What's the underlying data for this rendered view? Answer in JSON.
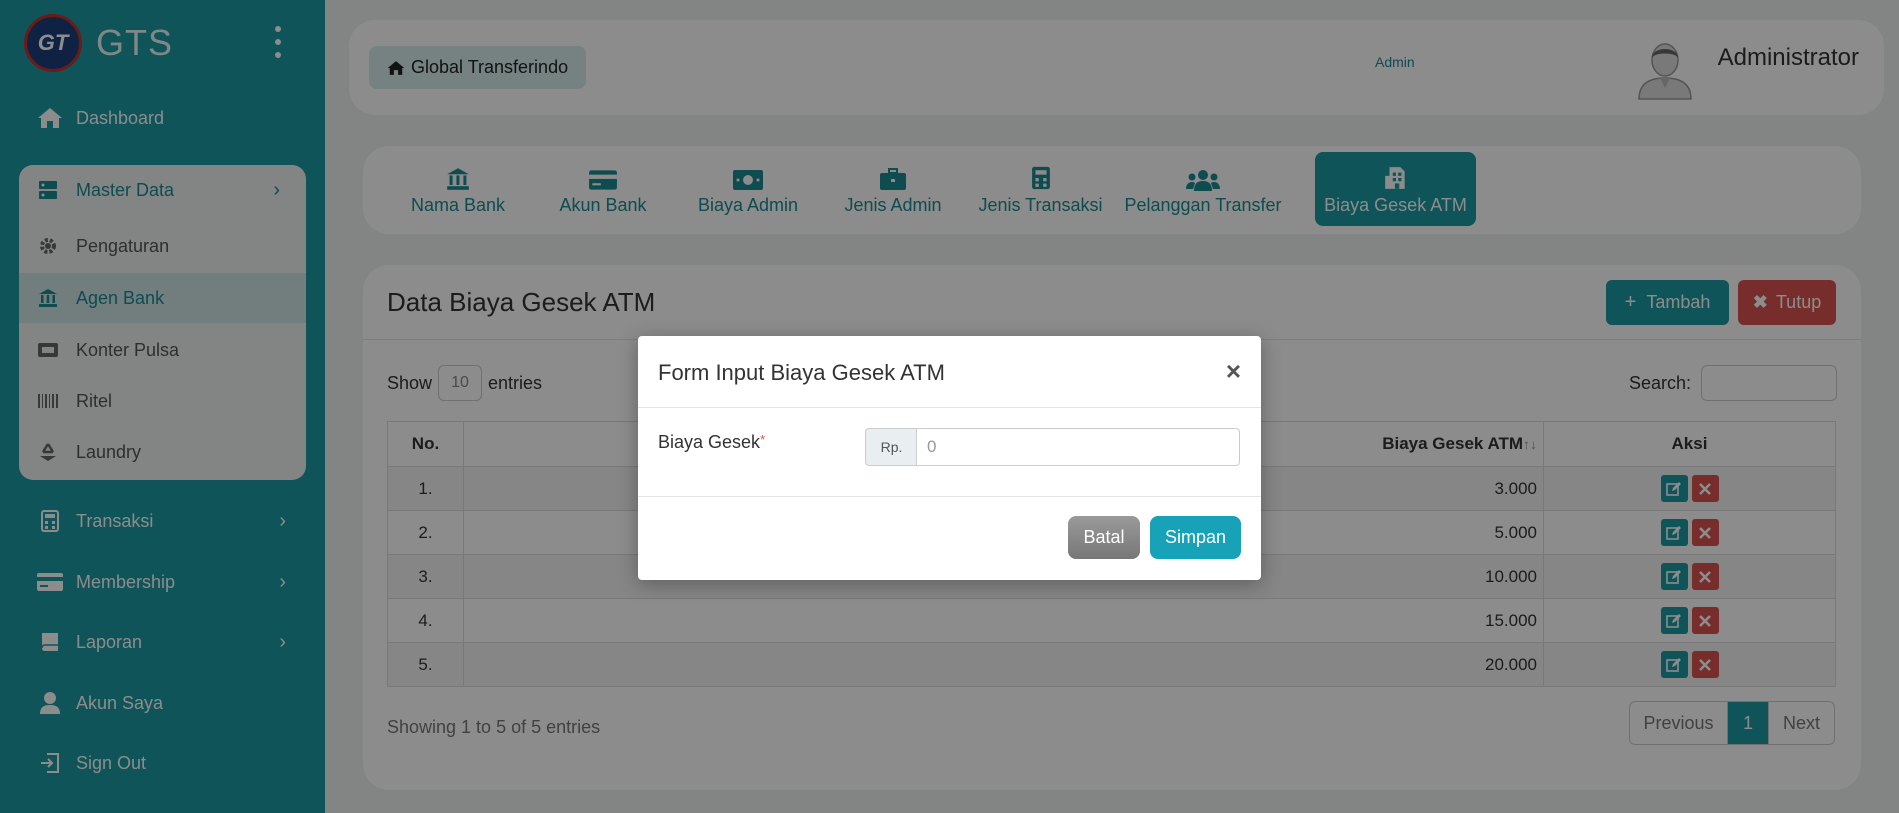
{
  "brand": {
    "logo_text": "GT",
    "name": "GTS"
  },
  "nav": {
    "dashboard": "Dashboard",
    "master_data": "Master Data",
    "submenu": [
      "Pengaturan",
      "Agen Bank",
      "Konter Pulsa",
      "Ritel",
      "Laundry"
    ],
    "transaksi": "Transaksi",
    "membership": "Membership",
    "laporan": "Laporan",
    "akun_saya": "Akun Saya",
    "sign_out": "Sign Out"
  },
  "header": {
    "breadcrumb": "Global Transferindo",
    "user_name": "Administrator",
    "user_role": "Admin"
  },
  "tabs": [
    "Nama Bank",
    "Akun Bank",
    "Biaya Admin",
    "Jenis Admin",
    "Jenis Transaksi",
    "Pelanggan Transfer",
    "Biaya Gesek ATM"
  ],
  "main": {
    "title": "Data Biaya Gesek ATM",
    "add_label": "Tambah",
    "close_label": "Tutup",
    "show_label": "Show",
    "entries_label": "entries",
    "page_length": "10",
    "search_label": "Search:",
    "columns": {
      "no": "No.",
      "value": "Biaya Gesek ATM",
      "action": "Aksi"
    },
    "rows": [
      {
        "no": "1.",
        "value": "3.000"
      },
      {
        "no": "2.",
        "value": "5.000"
      },
      {
        "no": "3.",
        "value": "10.000"
      },
      {
        "no": "4.",
        "value": "15.000"
      },
      {
        "no": "5.",
        "value": "20.000"
      }
    ],
    "info": "Showing 1 to 5 of 5 entries",
    "pager": {
      "prev": "Previous",
      "current": "1",
      "next": "Next"
    }
  },
  "modal": {
    "title": "Form Input Biaya Gesek ATM",
    "close": "×",
    "field_label": "Biaya Gesek",
    "required_mark": "*",
    "addon": "Rp.",
    "placeholder": "0",
    "cancel": "Batal",
    "save": "Simpan"
  },
  "colors": {
    "primary": "#1a9aa0",
    "danger": "#d9534f",
    "info": "#17a2b8"
  }
}
